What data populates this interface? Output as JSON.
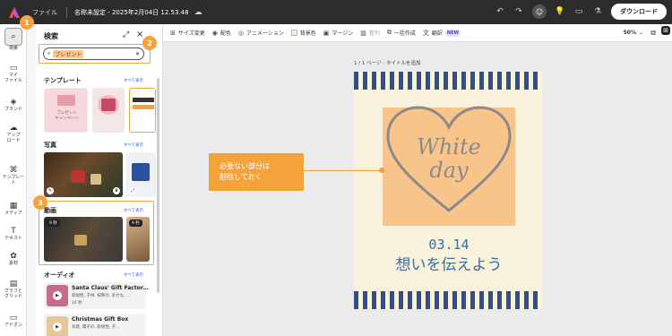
{
  "topbar": {
    "menu_file": "ファイル",
    "doc_title": "名称未設定 - 2025年2月04日 12.53.48",
    "download_label": "ダウンロード"
  },
  "toolbar": {
    "resize": "サイズ変更",
    "color": "配色",
    "animation": "アニメーション",
    "background": "背景色",
    "margin": "マージン",
    "arrange": "整列",
    "batch": "一括作成",
    "translate": "翻訳",
    "new_badge": "NEW",
    "zoom": "50%"
  },
  "rail": {
    "search": "検索",
    "my_files_1": "マイ",
    "my_files_2": "ファイル",
    "brand": "ブランド",
    "upload_1": "アップ",
    "upload_2": "ロード",
    "templates_1": "テンプレー",
    "templates_2": "ト",
    "media": "メディア",
    "text": "テキスト",
    "elements": "素材",
    "grids_1": "グラフと",
    "grids_2": "グリッド",
    "addons": "アドオン"
  },
  "panel": {
    "title": "検索",
    "search_value": "プレゼント",
    "templates_title": "テンプレート",
    "photos_title": "写真",
    "videos_title": "動画",
    "audio_title": "オーディオ",
    "see_all": "すべて表示",
    "template1_line1": "プレゼント",
    "template1_line2": "キャンペーン",
    "video1_time": "9 秒",
    "video2_time": "9 秒",
    "audio": [
      {
        "title": "Santa Claus' Gift Factor…",
        "tags": "新規性, 子供, 祝祭の, 幸せな, …",
        "duration": "16 秒"
      },
      {
        "title": "Christmas Gift Box",
        "tags": "背景, 電子の, 新規性, 子…",
        "duration": ""
      }
    ]
  },
  "annotations": {
    "n1": "1",
    "n2": "2",
    "n3": "3"
  },
  "canvas": {
    "page_label": "1 / 1 ページ - タイトルを追加",
    "heart_text_1": "White",
    "heart_text_2": "day",
    "date": "03.14",
    "tagline": "想いを伝えよう"
  },
  "callout": {
    "line1": "必要ない部分は",
    "line2": "削除しておく"
  },
  "colors": {
    "accent": "#f4a23a",
    "stripe": "#2f4f8a",
    "heart_bg": "#f8c48a",
    "heart_stroke": "#8a8a8a",
    "text_blue": "#3b6ea5"
  }
}
